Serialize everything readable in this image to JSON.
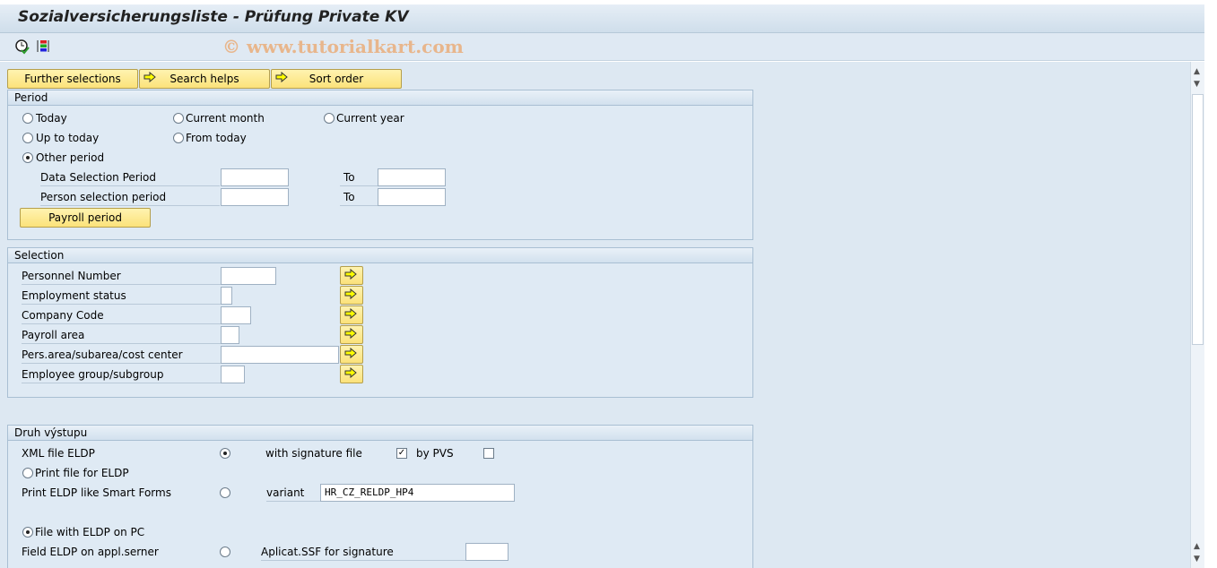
{
  "title": "Sozialversicherungsliste - Prüfung Private KV",
  "watermark": "© www.tutorialkart.com",
  "toolbar": {
    "icons": [
      "execute-clock-icon",
      "selection-options-icon"
    ]
  },
  "buttons": {
    "further": "Further selections",
    "search": "Search helps",
    "sort": "Sort order"
  },
  "period": {
    "title": "Period",
    "today": "Today",
    "current_month": "Current month",
    "current_year": "Current year",
    "up_to_today": "Up to today",
    "from_today": "From today",
    "other_period": "Other period",
    "selected": "other_period",
    "data_sel": "Data Selection Period",
    "person_sel": "Person selection period",
    "to": "To",
    "payroll_btn": "Payroll period"
  },
  "selection": {
    "title": "Selection",
    "rows": [
      "Personnel Number",
      "Employment status",
      "Company Code",
      "Payroll area",
      "Pers.area/subarea/cost center",
      "Employee group/subgroup"
    ]
  },
  "output": {
    "title": "Druh výstupu",
    "xml": "XML file ELDP",
    "with_sig": "with signature file",
    "with_sig_checked": true,
    "by_pvs": "by PVS",
    "by_pvs_checked": false,
    "print_file": "Print file for ELDP",
    "print_smart": "Print ELDP like Smart Forms",
    "variant": "variant",
    "variant_value": "HR_CZ_RELDP_HP4",
    "file_pc": "File with ELDP on PC",
    "field_appl": "Field ELDP on appl.serner",
    "ssf": "Aplicat.SSF for signature",
    "xml_selected": true,
    "file_pc_selected": true
  }
}
